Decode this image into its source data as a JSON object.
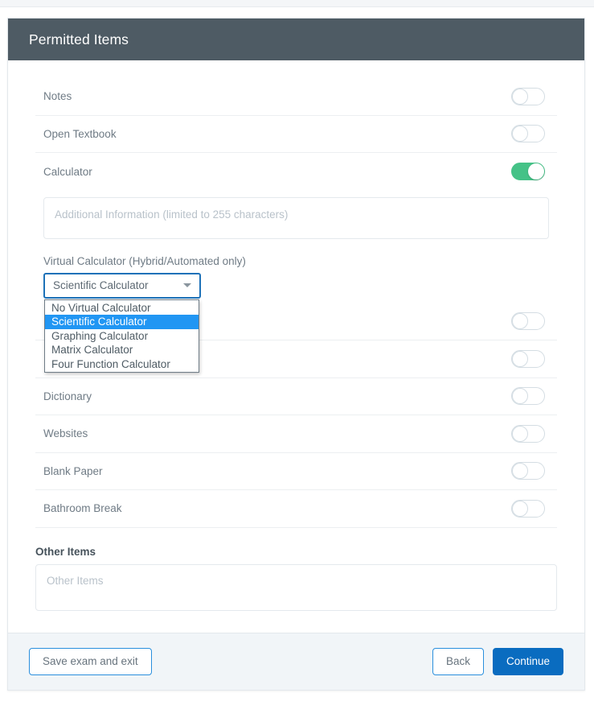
{
  "header": {
    "title": "Permitted Items"
  },
  "colors": {
    "header_bg": "#4e5b64",
    "toggle_on": "#45c287",
    "primary_button": "#0a6cc0",
    "outline_button_border": "#2a8fdd",
    "option_highlight": "#2196f3",
    "footer_bg": "#f1f5f8"
  },
  "items": [
    {
      "label": "Notes",
      "enabled": false
    },
    {
      "label": "Open Textbook",
      "enabled": false
    },
    {
      "label": "Calculator",
      "enabled": true
    }
  ],
  "calculator_panel": {
    "additional_info_placeholder": "Additional Information (limited to 255 characters)",
    "additional_info_value": "",
    "virtual_calculator_label": "Virtual Calculator (Hybrid/Automated only)",
    "selected_option": "Scientific Calculator",
    "options": [
      "No Virtual Calculator",
      "Scientific Calculator",
      "Graphing Calculator",
      "Matrix Calculator",
      "Four Function Calculator"
    ]
  },
  "obscured_items": [
    {
      "label": "",
      "enabled": false
    },
    {
      "label": "",
      "enabled": false
    }
  ],
  "items_after": [
    {
      "label": "Dictionary",
      "enabled": false
    },
    {
      "label": "Websites",
      "enabled": false
    },
    {
      "label": "Blank Paper",
      "enabled": false
    },
    {
      "label": "Bathroom Break",
      "enabled": false
    }
  ],
  "other_items": {
    "title": "Other Items",
    "placeholder": "Other Items",
    "value": ""
  },
  "footer": {
    "save_label": "Save exam and exit",
    "back_label": "Back",
    "continue_label": "Continue"
  }
}
